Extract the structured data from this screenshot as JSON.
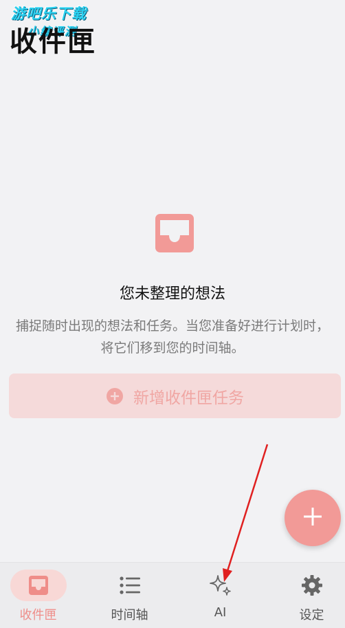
{
  "watermark": {
    "line1": "游吧乐下载",
    "line2": "小编评测"
  },
  "header": {
    "title": "收件匣"
  },
  "empty_state": {
    "icon": "inbox-icon",
    "title": "您未整理的想法",
    "description": "捕捉随时出现的想法和任务。当您准备好进行计划时，将它们移到您的时间轴。"
  },
  "add_button": {
    "icon": "plus-circle-icon",
    "label": "新增收件匣任务"
  },
  "fab": {
    "icon": "plus-icon"
  },
  "tabbar": {
    "items": [
      {
        "label": "收件匣",
        "icon": "inbox-icon",
        "active": true
      },
      {
        "label": "时间轴",
        "icon": "list-icon",
        "active": false
      },
      {
        "label": "AI",
        "icon": "sparkle-icon",
        "active": false
      },
      {
        "label": "设定",
        "icon": "gear-icon",
        "active": false
      }
    ]
  },
  "colors": {
    "accent": "#f29a97",
    "accent_light": "#f5dada",
    "background": "#f2f2f4",
    "annotation_arrow": "#e02020"
  }
}
